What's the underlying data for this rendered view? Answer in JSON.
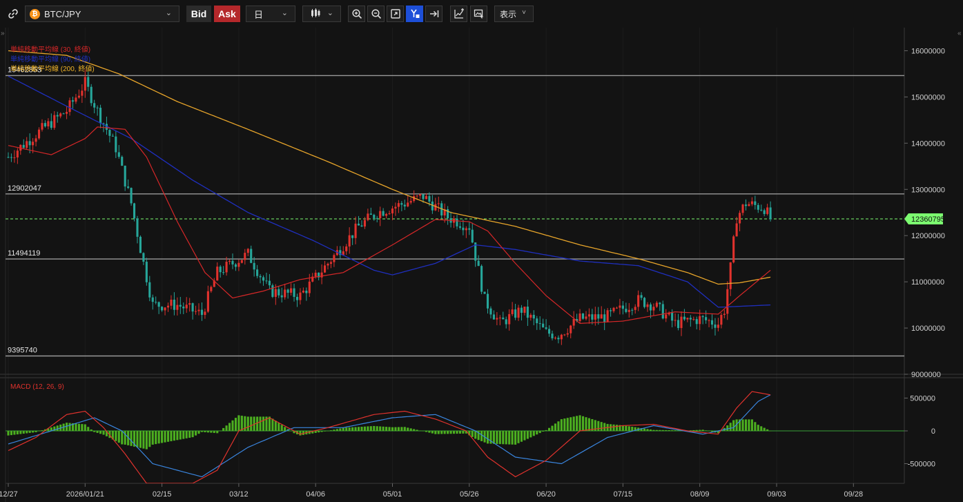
{
  "toolbar": {
    "symbol": "BTC/JPY",
    "coin_glyph": "₿",
    "bid_label": "Bid",
    "ask_label": "Ask",
    "period_label": "日",
    "display_label": "表示",
    "icons": [
      "link-icon",
      "zoom-in-icon",
      "zoom-out-icon",
      "fit-screen-icon",
      "y-axis-scale-icon",
      "jump-to-latest-icon",
      "add-indicator-icon",
      "screenshot-icon"
    ]
  },
  "main_chart": {
    "legends": [
      {
        "text": "単純移動平均線 (30, 終値)",
        "color": "#d62728"
      },
      {
        "text": "単純移動平均線 (90, 終値)",
        "color": "#1f2fbf"
      },
      {
        "text": "単純移動平均線 (200, 終値)",
        "color": "#f0b429"
      }
    ],
    "price_axis_ticks": [
      "16000000",
      "15000000",
      "14000000",
      "13000000",
      "12000000",
      "11000000",
      "10000000",
      "9000000"
    ],
    "current_price": "12360795",
    "horizontal_lines": [
      "15462853",
      "12902047",
      "11494119",
      "9395740"
    ]
  },
  "macd_panel": {
    "label": "MACD (12, 26, 9)",
    "axis_ticks": [
      "500000",
      "0",
      "-500000"
    ]
  },
  "date_axis": [
    "12/27",
    "2026/01/21",
    "02/15",
    "03/12",
    "04/06",
    "05/01",
    "05/26",
    "06/20",
    "07/15",
    "08/09",
    "09/03",
    "09/28"
  ],
  "colors": {
    "up": "#e0322d",
    "down": "#26a69a",
    "sma30": "#d62728",
    "sma90": "#1f2fbf",
    "sma200": "#e8a52a",
    "macd": "#e0322d",
    "signal": "#3a86e0",
    "hist": "#4caf20",
    "current_price_bg": "#7CFC70"
  },
  "chart_data": {
    "type": "candlestick",
    "x_start": "2025-12-27",
    "x_end": "2026-09-03",
    "price_range": [
      9000000,
      16500000
    ],
    "macd_range": [
      -800000,
      800000
    ],
    "anchors": [
      [
        "2025-12-27",
        13700000
      ],
      [
        "2026-01-07",
        14300000
      ],
      [
        "2026-01-15",
        14700000
      ],
      [
        "2026-01-21",
        15300000
      ],
      [
        "2026-01-25",
        14700000
      ],
      [
        "2026-01-31",
        13900000
      ],
      [
        "2026-02-05",
        12700000
      ],
      [
        "2026-02-09",
        11400000
      ],
      [
        "2026-02-12",
        10500000
      ],
      [
        "2026-02-20",
        10500000
      ],
      [
        "2026-02-28",
        10300000
      ],
      [
        "2026-03-05",
        11200000
      ],
      [
        "2026-03-15",
        11600000
      ],
      [
        "2026-03-22",
        10800000
      ],
      [
        "2026-04-01",
        10700000
      ],
      [
        "2026-04-10",
        11400000
      ],
      [
        "2026-04-20",
        12200000
      ],
      [
        "2026-04-26",
        12500000
      ],
      [
        "2026-05-05",
        12700000
      ],
      [
        "2026-05-11",
        12850000
      ],
      [
        "2026-05-19",
        12400000
      ],
      [
        "2026-05-26",
        12200000
      ],
      [
        "2026-05-31",
        10600000
      ],
      [
        "2026-06-05",
        10100000
      ],
      [
        "2026-06-12",
        10400000
      ],
      [
        "2026-06-20",
        9900000
      ],
      [
        "2026-06-24",
        9850000
      ],
      [
        "2026-07-01",
        10200000
      ],
      [
        "2026-07-10",
        10250000
      ],
      [
        "2026-07-20",
        10600000
      ],
      [
        "2026-07-25",
        10500000
      ],
      [
        "2026-08-01",
        10100000
      ],
      [
        "2026-08-09",
        10200000
      ],
      [
        "2026-08-15",
        10100000
      ],
      [
        "2026-08-17",
        10400000
      ],
      [
        "2026-08-19",
        11300000
      ],
      [
        "2026-08-21",
        12400000
      ],
      [
        "2026-08-24",
        12700000
      ],
      [
        "2026-08-27",
        12650000
      ],
      [
        "2026-08-30",
        12600000
      ],
      [
        "2026-09-01",
        12360795
      ]
    ],
    "sma30": [
      [
        "2025-12-27",
        13950000
      ],
      [
        "2026-01-10",
        13750000
      ],
      [
        "2026-01-21",
        14100000
      ],
      [
        "2026-01-25",
        14350000
      ],
      [
        "2026-02-03",
        14300000
      ],
      [
        "2026-02-10",
        13700000
      ],
      [
        "2026-02-20",
        12300000
      ],
      [
        "2026-03-01",
        11200000
      ],
      [
        "2026-03-10",
        10650000
      ],
      [
        "2026-03-20",
        10800000
      ],
      [
        "2026-04-01",
        11050000
      ],
      [
        "2026-04-15",
        11200000
      ],
      [
        "2026-05-01",
        11800000
      ],
      [
        "2026-05-15",
        12350000
      ],
      [
        "2026-05-26",
        12300000
      ],
      [
        "2026-06-01",
        12100000
      ],
      [
        "2026-06-10",
        11400000
      ],
      [
        "2026-06-20",
        10700000
      ],
      [
        "2026-07-01",
        10100000
      ],
      [
        "2026-07-15",
        10150000
      ],
      [
        "2026-08-01",
        10350000
      ],
      [
        "2026-08-15",
        10300000
      ],
      [
        "2026-08-22",
        10700000
      ],
      [
        "2026-09-01",
        11250000
      ]
    ],
    "sma90": [
      [
        "2025-12-27",
        15450000
      ],
      [
        "2026-01-15",
        14800000
      ],
      [
        "2026-02-05",
        14100000
      ],
      [
        "2026-02-25",
        13200000
      ],
      [
        "2026-03-15",
        12500000
      ],
      [
        "2026-04-05",
        11900000
      ],
      [
        "2026-04-25",
        11250000
      ],
      [
        "2026-05-01",
        11150000
      ],
      [
        "2026-05-15",
        11400000
      ],
      [
        "2026-05-28",
        11800000
      ],
      [
        "2026-06-10",
        11700000
      ],
      [
        "2026-07-01",
        11450000
      ],
      [
        "2026-07-20",
        11350000
      ],
      [
        "2026-08-05",
        11000000
      ],
      [
        "2026-08-15",
        10450000
      ],
      [
        "2026-09-01",
        10500000
      ]
    ],
    "sma200": [
      [
        "2025-12-27",
        16000000
      ],
      [
        "2026-01-15",
        15900000
      ],
      [
        "2026-02-01",
        15500000
      ],
      [
        "2026-02-20",
        14900000
      ],
      [
        "2026-03-15",
        14300000
      ],
      [
        "2026-04-10",
        13600000
      ],
      [
        "2026-05-01",
        13000000
      ],
      [
        "2026-05-20",
        12500000
      ],
      [
        "2026-06-10",
        12200000
      ],
      [
        "2026-07-01",
        11800000
      ],
      [
        "2026-07-20",
        11500000
      ],
      [
        "2026-08-05",
        11200000
      ],
      [
        "2026-08-15",
        10950000
      ],
      [
        "2026-08-22",
        10980000
      ],
      [
        "2026-09-01",
        11100000
      ]
    ],
    "macd": [
      [
        "2025-12-27",
        -300000
      ],
      [
        "2026-01-05",
        -100000
      ],
      [
        "2026-01-15",
        250000
      ],
      [
        "2026-01-21",
        300000
      ],
      [
        "2026-01-27",
        50000
      ],
      [
        "2026-02-03",
        -350000
      ],
      [
        "2026-02-10",
        -800000
      ],
      [
        "2026-02-25",
        -800000
      ],
      [
        "2026-03-05",
        -600000
      ],
      [
        "2026-03-12",
        0
      ],
      [
        "2026-03-22",
        200000
      ],
      [
        "2026-04-01",
        -50000
      ],
      [
        "2026-04-10",
        50000
      ],
      [
        "2026-04-25",
        250000
      ],
      [
        "2026-05-05",
        300000
      ],
      [
        "2026-05-15",
        180000
      ],
      [
        "2026-05-25",
        0
      ],
      [
        "2026-06-01",
        -400000
      ],
      [
        "2026-06-10",
        -700000
      ],
      [
        "2026-06-20",
        -450000
      ],
      [
        "2026-07-01",
        0
      ],
      [
        "2026-07-15",
        80000
      ],
      [
        "2026-07-25",
        100000
      ],
      [
        "2026-08-05",
        0
      ],
      [
        "2026-08-15",
        -50000
      ],
      [
        "2026-08-21",
        350000
      ],
      [
        "2026-08-26",
        600000
      ],
      [
        "2026-09-01",
        550000
      ]
    ],
    "signal": [
      [
        "2025-12-27",
        -200000
      ],
      [
        "2026-01-10",
        0
      ],
      [
        "2026-01-24",
        200000
      ],
      [
        "2026-02-02",
        0
      ],
      [
        "2026-02-12",
        -500000
      ],
      [
        "2026-02-28",
        -700000
      ],
      [
        "2026-03-15",
        -250000
      ],
      [
        "2026-03-30",
        50000
      ],
      [
        "2026-04-15",
        50000
      ],
      [
        "2026-05-01",
        200000
      ],
      [
        "2026-05-15",
        250000
      ],
      [
        "2026-05-28",
        0
      ],
      [
        "2026-06-10",
        -400000
      ],
      [
        "2026-06-25",
        -500000
      ],
      [
        "2026-07-10",
        -100000
      ],
      [
        "2026-07-25",
        80000
      ],
      [
        "2026-08-10",
        -50000
      ],
      [
        "2026-08-20",
        50000
      ],
      [
        "2026-08-28",
        450000
      ],
      [
        "2026-09-01",
        550000
      ]
    ]
  }
}
